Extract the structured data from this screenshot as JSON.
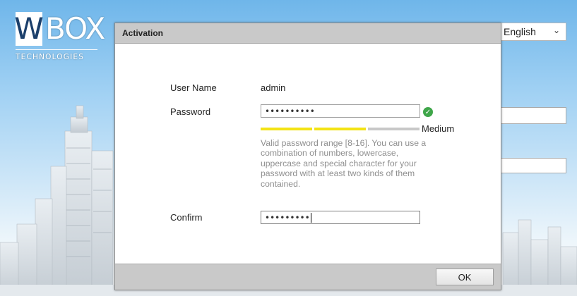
{
  "background": {
    "logo": {
      "main": "BOX",
      "letter": "W",
      "sub": "TECHNOLOGIES"
    },
    "language": {
      "selected": "English"
    }
  },
  "dialog": {
    "title": "Activation",
    "username": {
      "label": "User Name",
      "value": "admin"
    },
    "password": {
      "label": "Password",
      "masked_value": "••••••••••",
      "status_icon": "check-circle-icon",
      "strength_label": "Medium",
      "strength_level": 0.67,
      "hint": "Valid password range [8-16]. You can use a combination of numbers, lowercase, uppercase and special character for your password with at least two kinds of them contained."
    },
    "confirm": {
      "label": "Confirm",
      "masked_value": "•••••••••"
    },
    "ok_label": "OK"
  },
  "colors": {
    "strength_filled": "#f3e315",
    "strength_empty": "#c8c8c8",
    "header_bar": "#c9c9c9",
    "valid_icon": "#3fa64a"
  }
}
